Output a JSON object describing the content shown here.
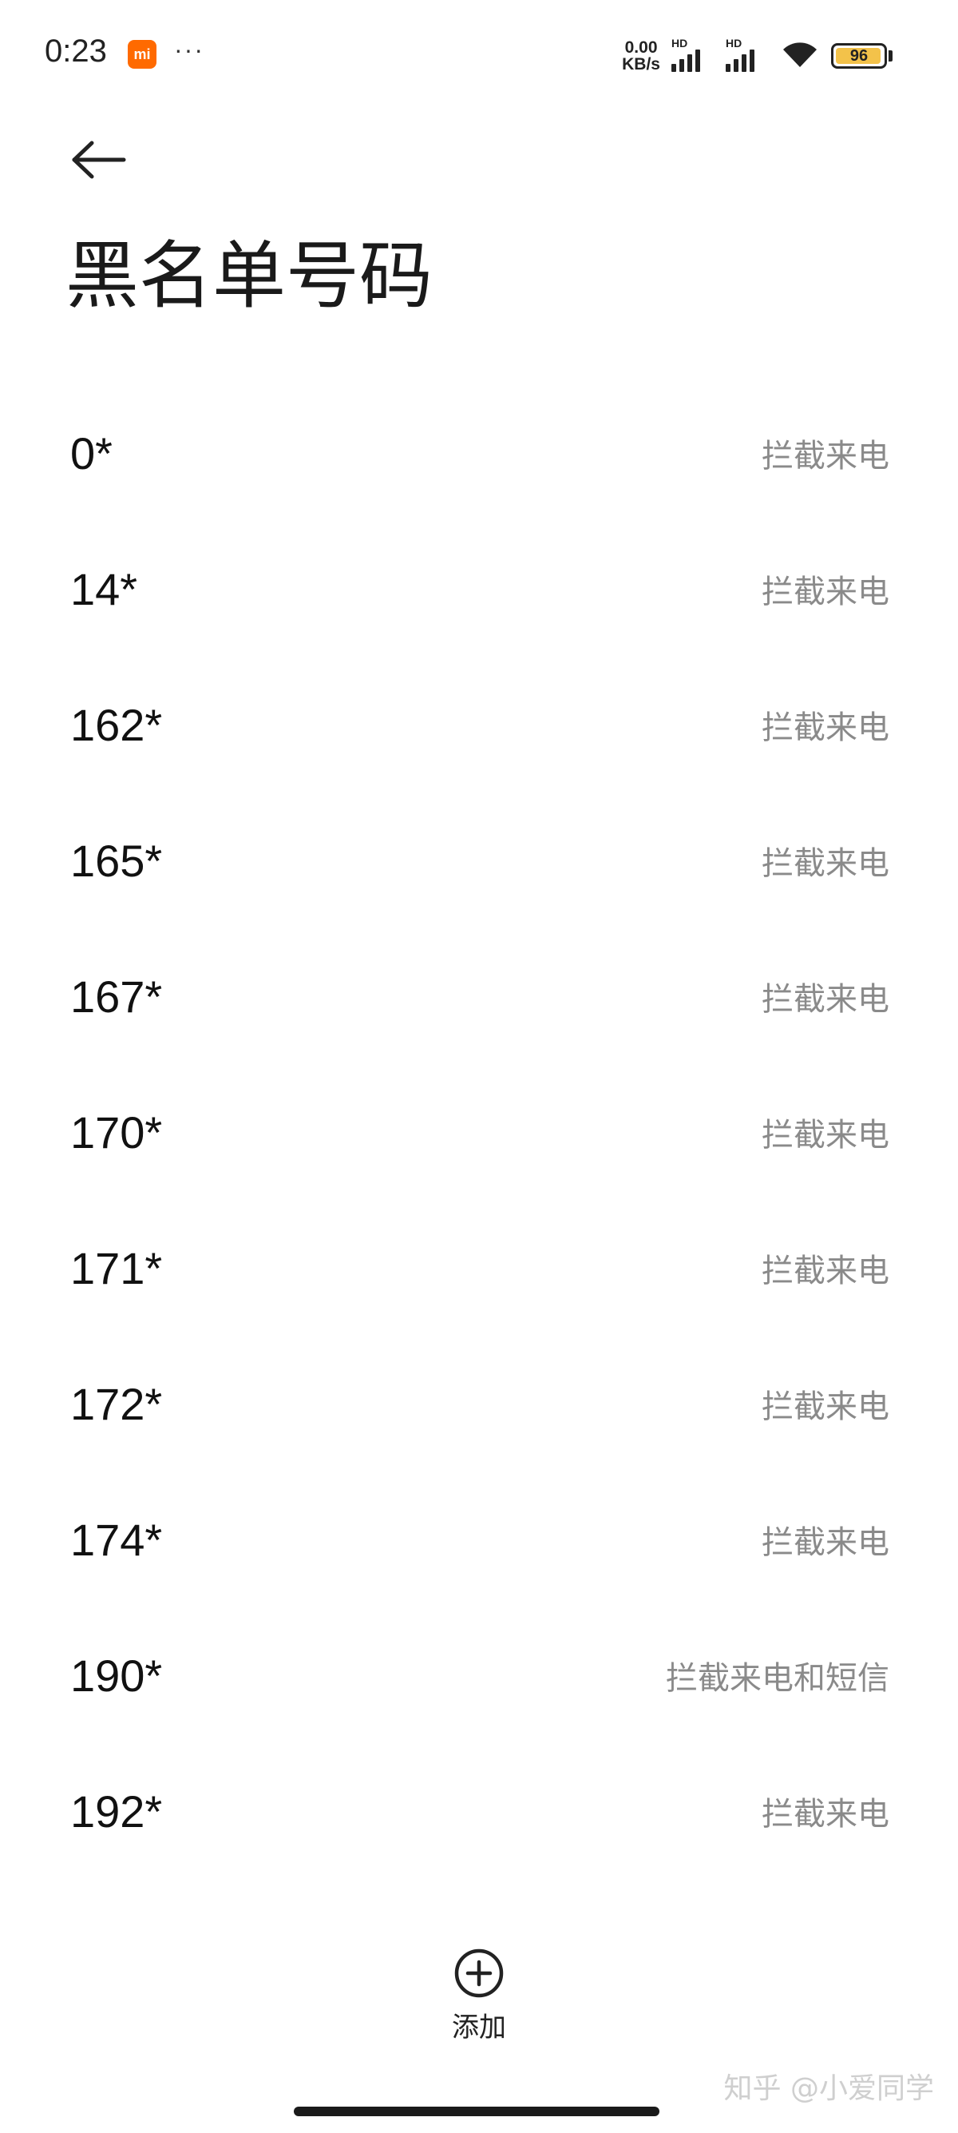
{
  "status_bar": {
    "time": "0:23",
    "app_badge": "mi",
    "more": "···",
    "speed_value": "0.00",
    "speed_unit": "KB/s",
    "sim1_label": "HD",
    "sim2_label": "HD",
    "battery_level": "96",
    "battery_fraction": 0.96,
    "battery_color": "#f3c24a"
  },
  "header": {
    "title": "黑名单号码"
  },
  "blacklist": {
    "items": [
      {
        "number": "0*",
        "mode": "拦截来电"
      },
      {
        "number": "14*",
        "mode": "拦截来电"
      },
      {
        "number": "162*",
        "mode": "拦截来电"
      },
      {
        "number": "165*",
        "mode": "拦截来电"
      },
      {
        "number": "167*",
        "mode": "拦截来电"
      },
      {
        "number": "170*",
        "mode": "拦截来电"
      },
      {
        "number": "171*",
        "mode": "拦截来电"
      },
      {
        "number": "172*",
        "mode": "拦截来电"
      },
      {
        "number": "174*",
        "mode": "拦截来电"
      },
      {
        "number": "190*",
        "mode": "拦截来电和短信"
      },
      {
        "number": "192*",
        "mode": "拦截来电"
      }
    ]
  },
  "footer": {
    "add_label": "添加"
  },
  "watermark": "知乎 @小爱同学",
  "icons": {
    "back": "arrow-left-icon",
    "add": "plus-circle-icon",
    "wifi": "wifi-icon",
    "signal": "signal-icon",
    "battery": "battery-icon"
  }
}
